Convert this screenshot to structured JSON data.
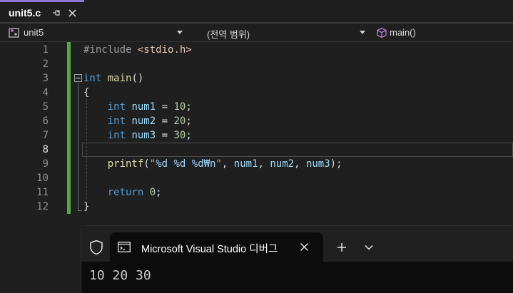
{
  "tab": {
    "title": "unit5.c"
  },
  "navbar": {
    "project": "unit5",
    "scope": "(전역 범위)",
    "member": "main()"
  },
  "editor": {
    "line_numbers": [
      "1",
      "2",
      "3",
      "4",
      "5",
      "6",
      "7",
      "8",
      "9",
      "10",
      "11",
      "12"
    ],
    "lines": {
      "l1_directive": "#include",
      "l1_header": "<stdio.h>",
      "l3_type": "int",
      "l3_func": "main",
      "l3_rest": "()",
      "l4": "{",
      "l5_type": "int",
      "l5_var": "num1",
      "l5_op": " = ",
      "l5_val": "10",
      "l5_end": ";",
      "l6_type": "int",
      "l6_var": "num2",
      "l6_op": " = ",
      "l6_val": "20",
      "l6_end": ";",
      "l7_type": "int",
      "l7_var": "num3",
      "l7_op": " = ",
      "l7_val": "30",
      "l7_end": ";",
      "l9_func": "printf",
      "l9_open": "(",
      "l9_q1": "\"",
      "l9_fmt1": "%d",
      "l9_sp1": " ",
      "l9_fmt2": "%d",
      "l9_sp2": " ",
      "l9_fmt3": "%d",
      "l9_esc": "₩n",
      "l9_q2": "\"",
      "l9_c1": ", ",
      "l9_a1": "num1",
      "l9_c2": ", ",
      "l9_a2": "num2",
      "l9_c3": ", ",
      "l9_a3": "num3",
      "l9_close": ");",
      "l11_kw": "return",
      "l11_val": "0",
      "l11_end": ";",
      "l12": "}"
    }
  },
  "console": {
    "title": "Microsoft Visual Studio 디버그",
    "output": "10 20 30"
  }
}
